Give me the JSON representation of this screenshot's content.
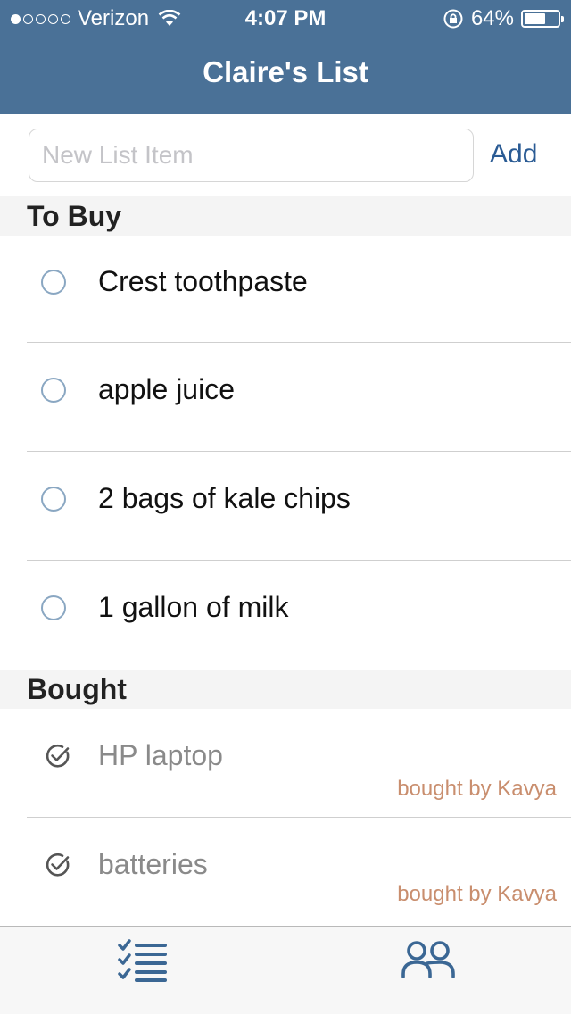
{
  "status_bar": {
    "signal_dots": [
      true,
      false,
      false,
      false,
      false
    ],
    "carrier": "Verizon",
    "time": "4:07 PM",
    "battery_percent": "64%",
    "battery_level": 0.64,
    "icons": [
      "wifi-icon",
      "rotation-lock-icon",
      "battery-icon"
    ]
  },
  "nav": {
    "title": "Claire's List"
  },
  "add_form": {
    "placeholder": "New List Item",
    "value": "",
    "add_label": "Add"
  },
  "sections": {
    "to_buy": {
      "title": "To Buy",
      "items": [
        "Crest toothpaste",
        "apple juice",
        "2 bags of kale chips",
        "1 gallon of milk"
      ]
    },
    "bought": {
      "title": "Bought",
      "items": [
        {
          "name": "HP laptop",
          "bought_by": "bought by Kavya"
        },
        {
          "name": "batteries",
          "bought_by": "bought by Kavya"
        }
      ]
    }
  },
  "tab_bar": {
    "tabs": [
      {
        "icon": "checklist-icon"
      },
      {
        "icon": "people-icon"
      }
    ]
  },
  "colors": {
    "accent": "#4a7197",
    "link": "#2a5b94",
    "bought_by": "#c98e6e",
    "tab_icon": "#3b6794"
  }
}
